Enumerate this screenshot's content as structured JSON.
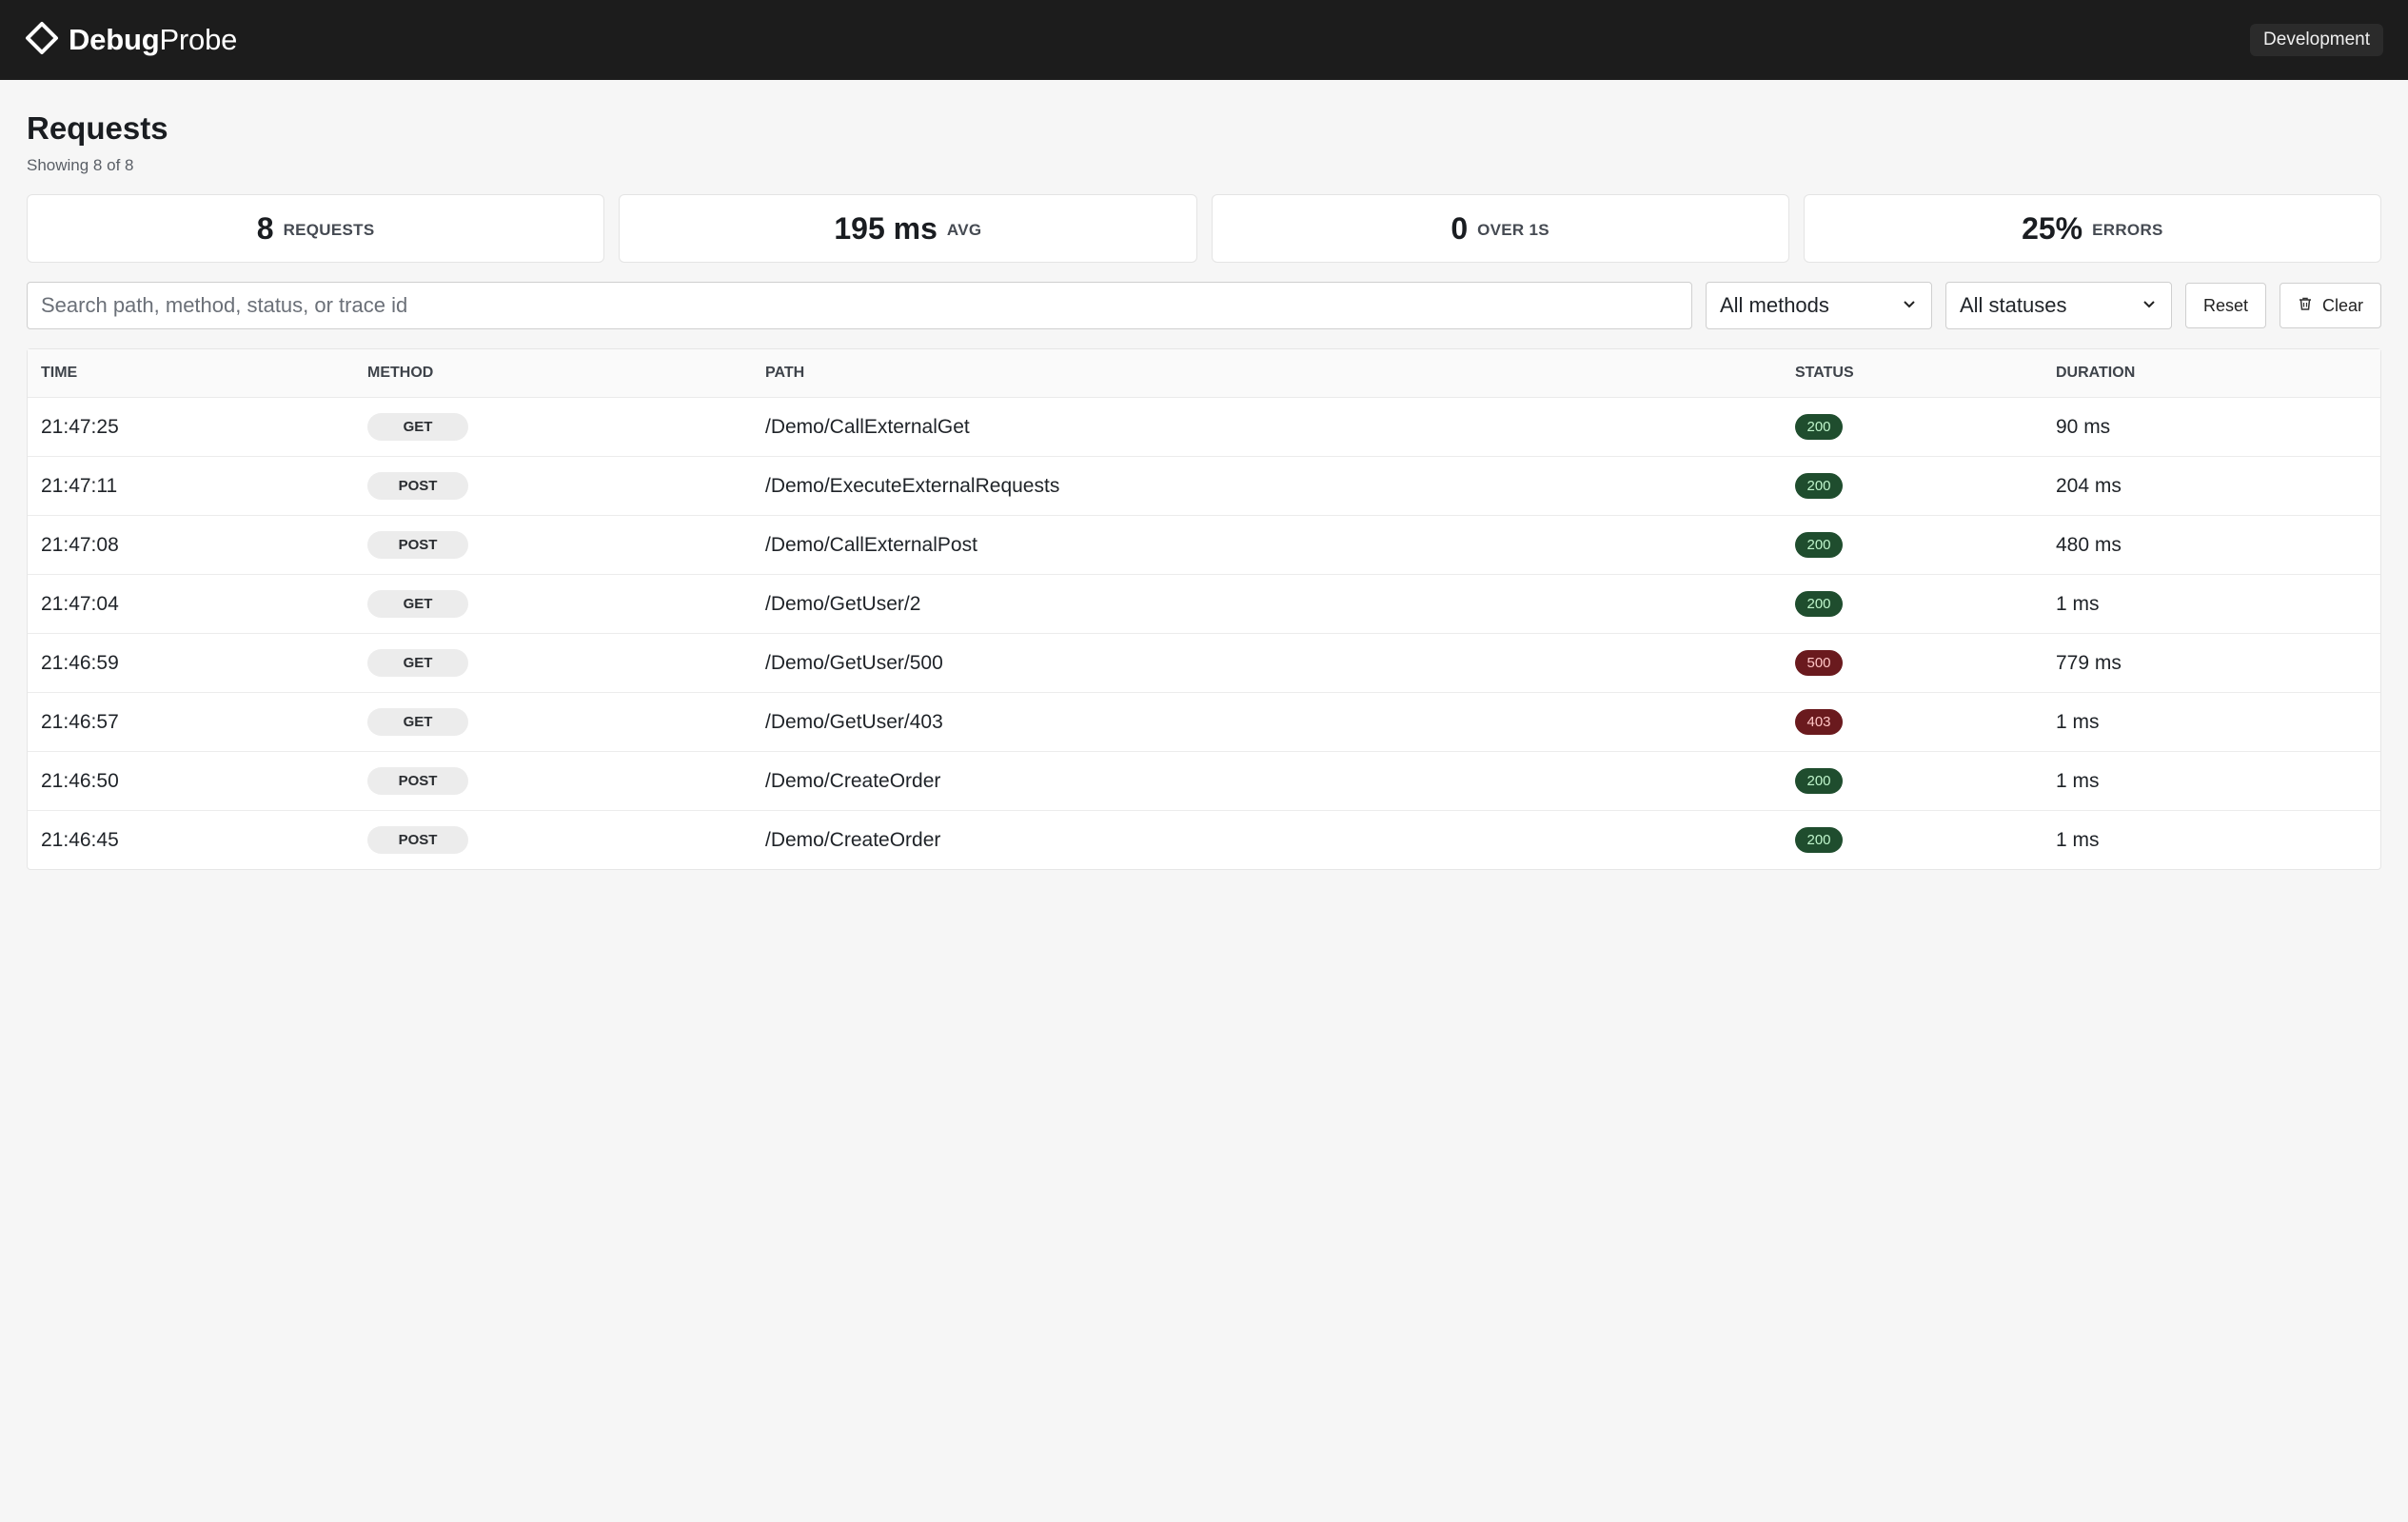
{
  "app": {
    "brand_bold": "Debug",
    "brand_light": "Probe",
    "environment": "Development",
    "logo_icon": "diamond-chevron-icon"
  },
  "page": {
    "title": "Requests",
    "subtitle": "Showing 8 of 8"
  },
  "stats": [
    {
      "value": "8",
      "label": "REQUESTS"
    },
    {
      "value": "195 ms",
      "label": "AVG"
    },
    {
      "value": "0",
      "label": "OVER 1S"
    },
    {
      "value": "25%",
      "label": "ERRORS"
    }
  ],
  "filters": {
    "search_placeholder": "Search path, method, status, or trace id",
    "method_select": "All methods",
    "status_select": "All statuses",
    "reset_label": "Reset",
    "clear_label": "Clear"
  },
  "table": {
    "columns": [
      "TIME",
      "METHOD",
      "PATH",
      "STATUS",
      "DURATION"
    ],
    "rows": [
      {
        "time": "21:47:25",
        "method": "GET",
        "path": "/Demo/CallExternalGet",
        "status": "200",
        "duration": "90 ms"
      },
      {
        "time": "21:47:11",
        "method": "POST",
        "path": "/Demo/ExecuteExternalRequests",
        "status": "200",
        "duration": "204 ms"
      },
      {
        "time": "21:47:08",
        "method": "POST",
        "path": "/Demo/CallExternalPost",
        "status": "200",
        "duration": "480 ms"
      },
      {
        "time": "21:47:04",
        "method": "GET",
        "path": "/Demo/GetUser/2",
        "status": "200",
        "duration": "1 ms"
      },
      {
        "time": "21:46:59",
        "method": "GET",
        "path": "/Demo/GetUser/500",
        "status": "500",
        "duration": "779 ms"
      },
      {
        "time": "21:46:57",
        "method": "GET",
        "path": "/Demo/GetUser/403",
        "status": "403",
        "duration": "1 ms"
      },
      {
        "time": "21:46:50",
        "method": "POST",
        "path": "/Demo/CreateOrder",
        "status": "200",
        "duration": "1 ms"
      },
      {
        "time": "21:46:45",
        "method": "POST",
        "path": "/Demo/CreateOrder",
        "status": "200",
        "duration": "1 ms"
      }
    ]
  },
  "colors": {
    "topbar": "#1c1c1c",
    "status_ok_bg": "#1f4d2e",
    "status_error_bg": "#6a1a1e"
  }
}
